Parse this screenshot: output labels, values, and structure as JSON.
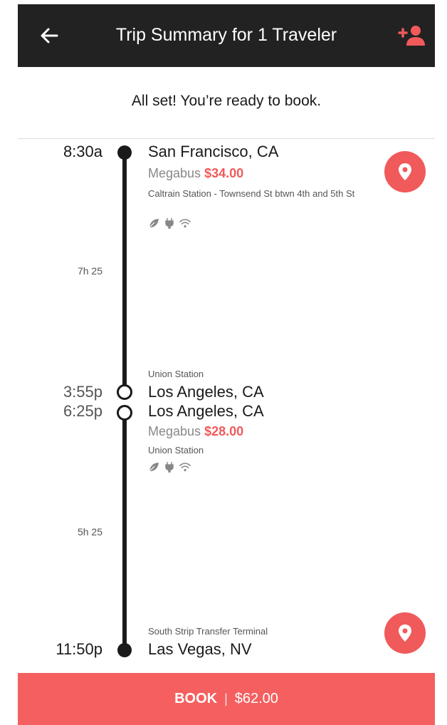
{
  "header": {
    "title": "Trip Summary for 1 Traveler",
    "back_icon": "arrow-left-icon",
    "add_traveler_icon": "add-person-icon",
    "background": "#222222",
    "accent": "#f05a5b"
  },
  "status": {
    "ready_text": "All set! You’re ready to book."
  },
  "itinerary": {
    "legs": [
      {
        "depart_time": "8:30a",
        "depart_city": "San Francisco, CA",
        "carrier": "Megabus",
        "price": "$34.00",
        "depart_station": "Caltrain Station - Townsend St btwn 4th and 5th St",
        "duration": "7h 25",
        "arrive_station": "Union Station",
        "arrive_time": "3:55p",
        "arrive_city": "Los Angeles, CA"
      },
      {
        "depart_time": "6:25p",
        "depart_city": "Los Angeles, CA",
        "carrier": "Megabus",
        "price": "$28.00",
        "depart_station": "Union Station",
        "duration": "5h 25",
        "arrive_station": "South Strip Transfer Terminal",
        "arrive_time": "11:50p",
        "arrive_city": "Las Vegas, NV"
      }
    ],
    "amenity_icons": [
      "leaf-icon",
      "plug-icon",
      "wifi-icon"
    ],
    "map_icon": "map-pin-icon"
  },
  "book": {
    "label": "BOOK",
    "separator": "|",
    "total": "$62.00",
    "color": "#f55f5f"
  }
}
